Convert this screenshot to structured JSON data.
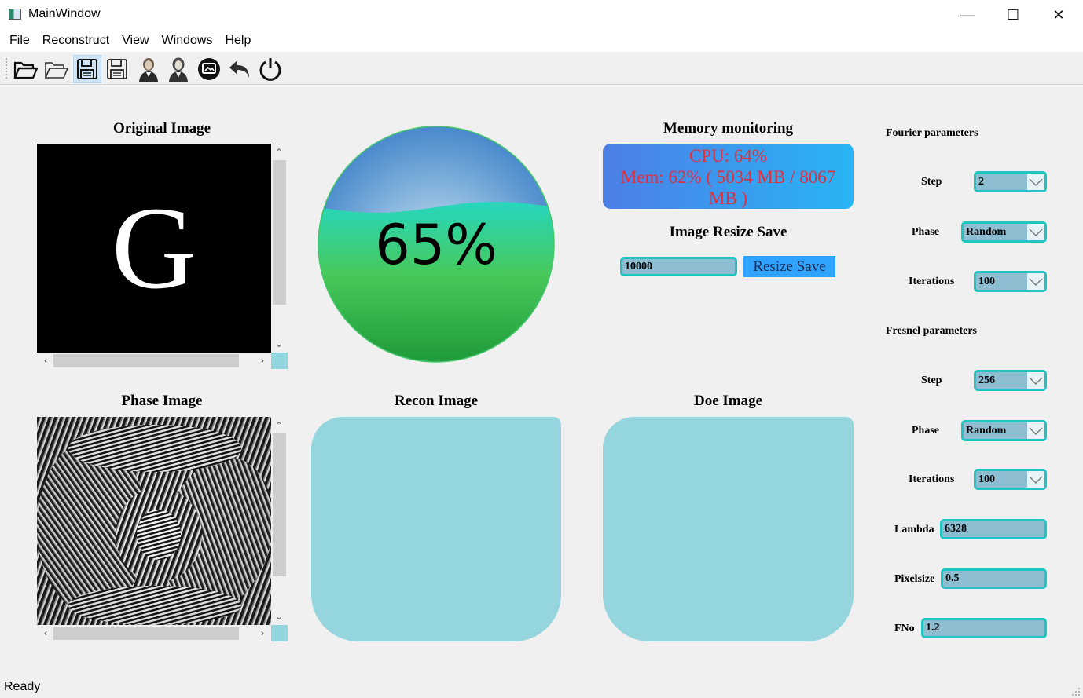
{
  "window": {
    "title": "MainWindow",
    "minimize_glyph": "—",
    "maximize_glyph": "☐",
    "close_glyph": "✕"
  },
  "menu": [
    "File",
    "Reconstruct",
    "View",
    "Windows",
    "Help"
  ],
  "toolbar": {
    "icons": [
      "open-file-icon",
      "open-folder-icon",
      "save-icon",
      "save-as-icon",
      "portrait-fourier-icon",
      "portrait-fresnel-icon",
      "screen-capture-icon",
      "undo-icon",
      "power-icon"
    ],
    "active_index": 2
  },
  "panels": {
    "original_image": {
      "title": "Original Image",
      "glyph": "G"
    },
    "phase_image": {
      "title": "Phase Image"
    },
    "recon_image": {
      "title": "Recon Image"
    },
    "doe_image": {
      "title": "Doe Image"
    }
  },
  "progress": {
    "value": 65,
    "label": "65%"
  },
  "memory": {
    "title": "Memory monitoring",
    "cpu_text": "CPU: 64%",
    "mem_text": "Mem: 62% ( 5034 MB / 8067 MB )"
  },
  "resize": {
    "title": "Image Resize Save",
    "value": "10000",
    "button_label": "Resize Save"
  },
  "fourier": {
    "title": "Fourier parameters",
    "step_label": "Step",
    "step_value": "2",
    "phase_label": "Phase",
    "phase_value": "Random",
    "iter_label": "Iterations",
    "iter_value": "100"
  },
  "fresnel": {
    "title": "Fresnel parameters",
    "step_label": "Step",
    "step_value": "256",
    "phase_label": "Phase",
    "phase_value": "Random",
    "iter_label": "Iterations",
    "iter_value": "100",
    "lambda_label": "Lambda",
    "lambda_value": "6328",
    "pixelsize_label": "Pixelsize",
    "pixelsize_value": "0.5",
    "fno_label": "FNo",
    "fno_value": "1.2"
  },
  "status": {
    "text": "Ready"
  },
  "colors": {
    "accent_cyan": "#20c4c0",
    "panel_cyan": "#95d5de",
    "field_fill": "#8cbdd1",
    "mem_text": "#e0303a",
    "button_blue": "#2fa3ff"
  }
}
